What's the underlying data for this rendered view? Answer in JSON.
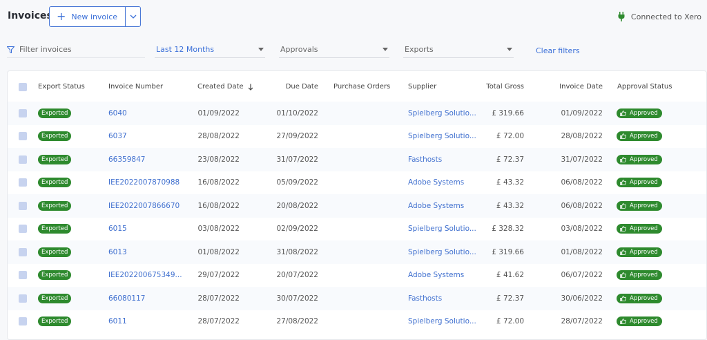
{
  "header": {
    "title": "Invoices",
    "new_button_label": "New invoice",
    "connection_status": "Connected to Xero"
  },
  "filters": {
    "search_placeholder": "Filter invoices",
    "date_range": "Last 12 Months",
    "approvals": "Approvals",
    "exports": "Exports",
    "clear_label": "Clear filters"
  },
  "table": {
    "columns": {
      "export_status": "Export Status",
      "invoice_number": "Invoice Number",
      "created_date": "Created Date",
      "due_date": "Due Date",
      "purchase_orders": "Purchase Orders",
      "supplier": "Supplier",
      "total_gross": "Total Gross",
      "invoice_date": "Invoice Date",
      "approval_status": "Approval Status"
    },
    "rows": [
      {
        "export_status": "Exported",
        "invoice_number": "6040",
        "created_date": "01/09/2022",
        "due_date": "01/10/2022",
        "purchase_orders": "",
        "supplier": "Spielberg Solutio...",
        "total_gross": "£ 319.66",
        "invoice_date": "01/09/2022",
        "approval_status": "Approved"
      },
      {
        "export_status": "Exported",
        "invoice_number": "6037",
        "created_date": "28/08/2022",
        "due_date": "27/09/2022",
        "purchase_orders": "",
        "supplier": "Spielberg Solutio...",
        "total_gross": "£ 72.00",
        "invoice_date": "28/08/2022",
        "approval_status": "Approved"
      },
      {
        "export_status": "Exported",
        "invoice_number": "66359847",
        "created_date": "23/08/2022",
        "due_date": "31/07/2022",
        "purchase_orders": "",
        "supplier": "Fasthosts",
        "total_gross": "£ 72.37",
        "invoice_date": "31/07/2022",
        "approval_status": "Approved"
      },
      {
        "export_status": "Exported",
        "invoice_number": "IEE2022007870988",
        "created_date": "16/08/2022",
        "due_date": "05/09/2022",
        "purchase_orders": "",
        "supplier": "Adobe Systems",
        "total_gross": "£ 43.32",
        "invoice_date": "06/08/2022",
        "approval_status": "Approved"
      },
      {
        "export_status": "Exported",
        "invoice_number": "IEE2022007866670",
        "created_date": "16/08/2022",
        "due_date": "20/08/2022",
        "purchase_orders": "",
        "supplier": "Adobe Systems",
        "total_gross": "£ 43.32",
        "invoice_date": "06/08/2022",
        "approval_status": "Approved"
      },
      {
        "export_status": "Exported",
        "invoice_number": "6015",
        "created_date": "03/08/2022",
        "due_date": "02/09/2022",
        "purchase_orders": "",
        "supplier": "Spielberg Solutio...",
        "total_gross": "£ 328.32",
        "invoice_date": "03/08/2022",
        "approval_status": "Approved"
      },
      {
        "export_status": "Exported",
        "invoice_number": "6013",
        "created_date": "01/08/2022",
        "due_date": "31/08/2022",
        "purchase_orders": "",
        "supplier": "Spielberg Solutio...",
        "total_gross": "£ 319.66",
        "invoice_date": "01/08/2022",
        "approval_status": "Approved"
      },
      {
        "export_status": "Exported",
        "invoice_number": "IEE202200675349...",
        "created_date": "29/07/2022",
        "due_date": "20/07/2022",
        "purchase_orders": "",
        "supplier": "Adobe Systems",
        "total_gross": "£ 41.62",
        "invoice_date": "06/07/2022",
        "approval_status": "Approved"
      },
      {
        "export_status": "Exported",
        "invoice_number": "66080117",
        "created_date": "28/07/2022",
        "due_date": "30/07/2022",
        "purchase_orders": "",
        "supplier": "Fasthosts",
        "total_gross": "£ 72.37",
        "invoice_date": "30/06/2022",
        "approval_status": "Approved"
      },
      {
        "export_status": "Exported",
        "invoice_number": "6011",
        "created_date": "28/07/2022",
        "due_date": "27/08/2022",
        "purchase_orders": "",
        "supplier": "Spielberg Solutio...",
        "total_gross": "£ 72.00",
        "invoice_date": "28/07/2022",
        "approval_status": "Approved"
      }
    ]
  },
  "colors": {
    "accent": "#3a6fd8",
    "status_green": "#2e8a2e",
    "checkbox": "#c7d3ef"
  },
  "icons": {
    "add": "plus-icon",
    "caret": "chevron-down-icon",
    "connection": "plug-icon",
    "filter": "filter-icon",
    "sort": "arrow-down-icon",
    "approved": "thumbs-up-icon"
  }
}
